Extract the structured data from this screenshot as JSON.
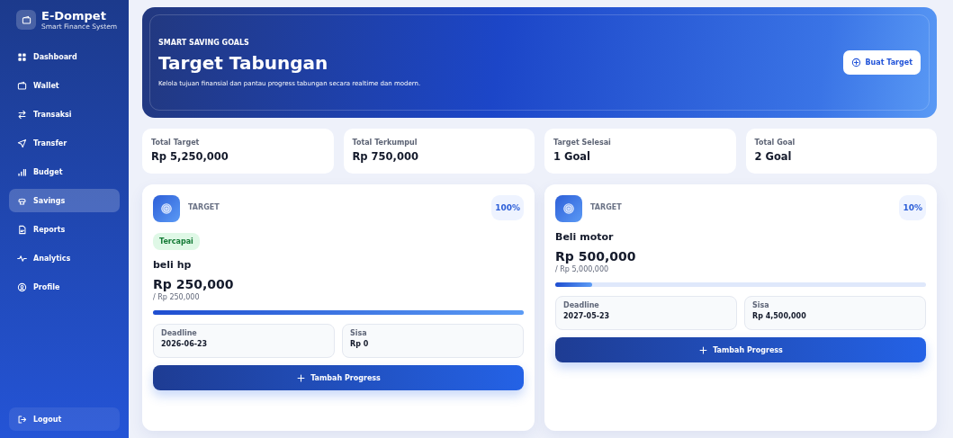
{
  "brand": {
    "title": "E-Dompet",
    "subtitle": "Smart Finance System"
  },
  "nav": [
    {
      "label": "Dashboard",
      "selected": false
    },
    {
      "label": "Wallet",
      "selected": false
    },
    {
      "label": "Transaksi",
      "selected": false
    },
    {
      "label": "Transfer",
      "selected": false
    },
    {
      "label": "Budget",
      "selected": false
    },
    {
      "label": "Savings",
      "selected": true
    },
    {
      "label": "Reports",
      "selected": false
    },
    {
      "label": "Analytics",
      "selected": false
    },
    {
      "label": "Profile",
      "selected": false
    }
  ],
  "logout": "Logout",
  "hero": {
    "eyebrow": "SMART SAVING GOALS",
    "title": "Target Tabungan",
    "subtitle": "Kelola tujuan finansial dan pantau progress tabungan secara realtime dan modern.",
    "button": "Buat Target"
  },
  "stats": [
    {
      "label": "Total Target",
      "value": "Rp 5,250,000"
    },
    {
      "label": "Total Terkumpul",
      "value": "Rp 750,000"
    },
    {
      "label": "Target Selesai",
      "value": "1 Goal"
    },
    {
      "label": "Total Goal",
      "value": "2 Goal"
    }
  ],
  "goals": [
    {
      "tag": "TARGET",
      "percent": "100%",
      "badge": "Tercapai",
      "name": "beli hp",
      "saved": "Rp 250,000",
      "target": "/ Rp 250,000",
      "level": 1,
      "deadline_label": "Deadline",
      "deadline": "2026-06-23",
      "remaining_label": "Sisa",
      "remaining": "Rp 0",
      "button": "Tambah Progress"
    },
    {
      "tag": "TARGET",
      "percent": "10%",
      "name": "Beli motor",
      "saved": "Rp 500,000",
      "target": "/ Rp 5,000,000",
      "level": 0.1,
      "deadline_label": "Deadline",
      "deadline": "2027-05-23",
      "remaining_label": "Sisa",
      "remaining": "Rp 4,500,000",
      "button": "Tambah Progress"
    }
  ]
}
